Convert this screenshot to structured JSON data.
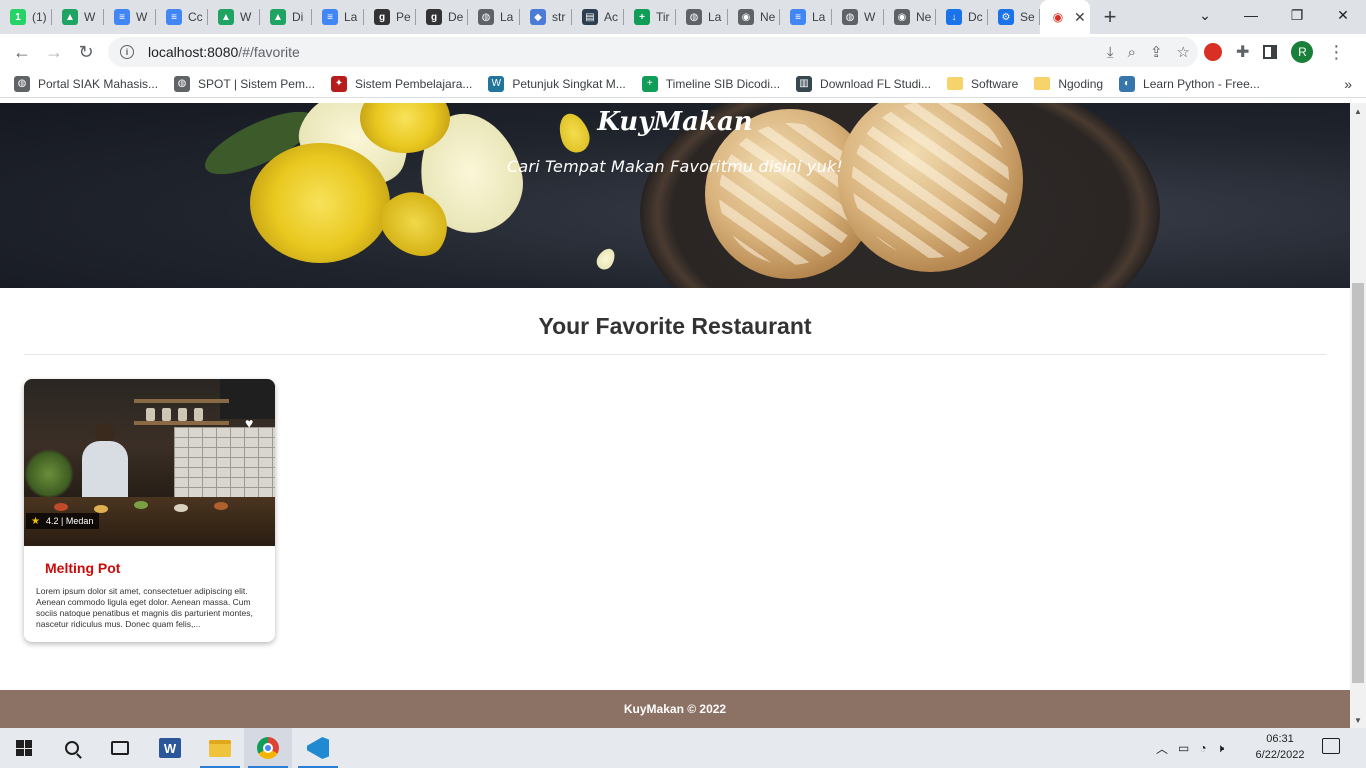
{
  "browser": {
    "tabs": [
      {
        "label": "(1)",
        "icon": "whatsapp-icon",
        "color": "#25d366",
        "glyph": "1"
      },
      {
        "label": "W",
        "icon": "google-drive-icon",
        "color": "#1fa463",
        "glyph": "▲"
      },
      {
        "label": "W",
        "icon": "google-docs-icon",
        "color": "#4285f4",
        "glyph": "≡"
      },
      {
        "label": "Cc",
        "icon": "google-docs-icon",
        "color": "#4285f4",
        "glyph": "≡"
      },
      {
        "label": "W",
        "icon": "google-drive-icon",
        "color": "#1fa463",
        "glyph": "▲"
      },
      {
        "label": "Di",
        "icon": "google-drive-icon",
        "color": "#1fa463",
        "glyph": "▲"
      },
      {
        "label": "La",
        "icon": "google-docs-icon",
        "color": "#4285f4",
        "glyph": "≡"
      },
      {
        "label": "Pe",
        "icon": "goodreads-icon",
        "color": "#333333",
        "glyph": "g"
      },
      {
        "label": "De",
        "icon": "goodreads-icon",
        "color": "#333333",
        "glyph": "g"
      },
      {
        "label": "La",
        "icon": "globe-icon",
        "color": "#5f6368",
        "glyph": "◍"
      },
      {
        "label": "str",
        "icon": "graduation-cap-icon",
        "color": "#4a7bd6",
        "glyph": "◆"
      },
      {
        "label": "Ac",
        "icon": "dicoding-icon",
        "color": "#2d3e50",
        "glyph": "▤"
      },
      {
        "label": "Tir",
        "icon": "google-sheets-icon",
        "color": "#0f9d58",
        "glyph": "+"
      },
      {
        "label": "La",
        "icon": "globe-icon",
        "color": "#5f6368",
        "glyph": "◍"
      },
      {
        "label": "Ne",
        "icon": "chrome-gray-icon",
        "color": "#5f6368",
        "glyph": "◉"
      },
      {
        "label": "La",
        "icon": "google-docs-icon",
        "color": "#4285f4",
        "glyph": "≡"
      },
      {
        "label": "W",
        "icon": "globe-icon",
        "color": "#5f6368",
        "glyph": "◍"
      },
      {
        "label": "Ne",
        "icon": "chrome-gray-icon",
        "color": "#5f6368",
        "glyph": "◉"
      },
      {
        "label": "Dc",
        "icon": "download-icon",
        "color": "#1a73e8",
        "glyph": "↓"
      },
      {
        "label": "Se",
        "icon": "settings-gear-icon",
        "color": "#1a73e8",
        "glyph": "⚙"
      }
    ],
    "active_tab_glyph": "◉",
    "active_tab_close": "✕",
    "new_tab": "+",
    "window_controls": {
      "chevron": "⌄",
      "minimize": "—",
      "restore": "❐",
      "close": "✕"
    },
    "url_host": "localhost:8080",
    "url_path": "/#/favorite",
    "profile_initial": "R",
    "bookmarks": [
      {
        "label": "Portal SIAK Mahasis...",
        "icon": "globe-icon",
        "color": "#5f6368",
        "glyph": "◍"
      },
      {
        "label": "SPOT | Sistem Pem...",
        "icon": "globe-icon",
        "color": "#5f6368",
        "glyph": "◍"
      },
      {
        "label": "Sistem Pembelajara...",
        "icon": "university-logo-icon",
        "color": "#b71c1c",
        "glyph": "✦"
      },
      {
        "label": "Petunjuk Singkat M...",
        "icon": "wordpress-icon",
        "color": "#21759b",
        "glyph": "W"
      },
      {
        "label": "Timeline SIB Dicodi...",
        "icon": "google-sheets-icon",
        "color": "#0f9d58",
        "glyph": "+"
      },
      {
        "label": "Download FL Studi...",
        "icon": "fl-studio-icon",
        "color": "#37474f",
        "glyph": "▥"
      },
      {
        "label": "Software",
        "icon": "folder-icon",
        "color": "#f6d36b",
        "glyph": ""
      },
      {
        "label": "Ngoding",
        "icon": "folder-icon",
        "color": "#f6d36b",
        "glyph": ""
      },
      {
        "label": "Learn Python - Free...",
        "icon": "python-icon",
        "color": "#3776ab",
        "glyph": "◐"
      }
    ],
    "bookmarks_more": "»"
  },
  "page": {
    "brand": "KuyMakan",
    "tagline": "Cari Tempat Makan Favoritmu disini yuk!",
    "section_title": "Your Favorite Restaurant",
    "restaurants": [
      {
        "name": "Melting Pot",
        "rating": "4.2",
        "city": "Medan",
        "rating_text": "4.2 | Medan",
        "description": "Lorem ipsum dolor sit amet, consectetuer adipiscing elit. Aenean commodo ligula eget dolor. Aenean massa. Cum sociis natoque penatibus et magnis dis parturient montes, nascetur ridiculus mus. Donec quam felis,..."
      }
    ],
    "footer": "KuyMakan © 2022",
    "colors": {
      "accent": "#cc0a0a",
      "footer_bg": "#8c7165",
      "star": "#f2c200"
    }
  },
  "taskbar": {
    "time": "06:31",
    "date": "6/22/2022",
    "apps": [
      "start-icon",
      "search-icon",
      "task-view-icon",
      "word-icon",
      "file-explorer-icon",
      "chrome-icon",
      "vscode-icon"
    ]
  }
}
